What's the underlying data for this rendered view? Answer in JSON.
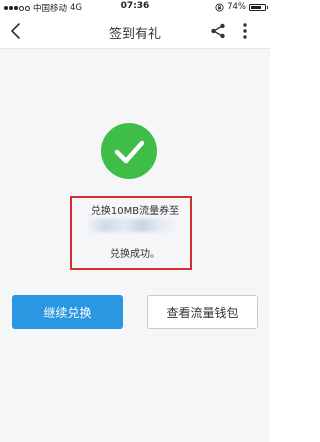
{
  "status_bar": {
    "carrier": "中国移动",
    "network": "4G",
    "time": "07:36",
    "battery_percent": "74%",
    "battery_level": 0.74
  },
  "nav": {
    "title": "签到有礼",
    "icons": [
      "back-arrow-icon",
      "share-icon",
      "more-vertical-icon"
    ]
  },
  "result": {
    "icon": "check-icon",
    "icon_color": "#3ebe48",
    "line1": "兑换10MB流量券至",
    "line3": "兑换成功。"
  },
  "actions": {
    "continue_label": "继续兑换",
    "continue_color": "#2a97e0",
    "wallet_label": "查看流量钱包"
  }
}
